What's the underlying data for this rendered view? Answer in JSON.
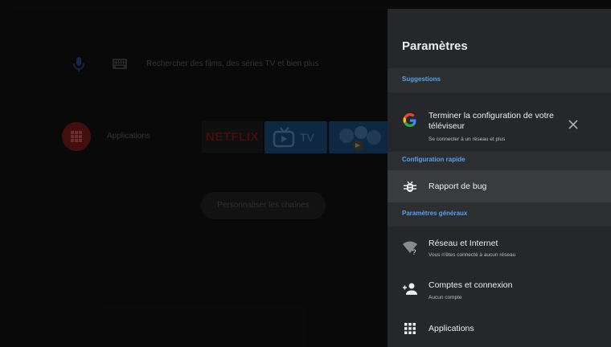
{
  "home": {
    "search_placeholder": "Rechercher des films, des séries TV et bien plus",
    "apps_label": "Applications",
    "netflix_label": "NETFLIX",
    "tv_label": "TV",
    "customize_label": "Personnaliser les chaînes"
  },
  "settings": {
    "title": "Paramètres",
    "sections": {
      "suggestions": "Suggestions",
      "quick": "Configuration rapide",
      "general": "Paramètres généraux"
    },
    "suggestion": {
      "title": "Terminer la configuration de votre téléviseur",
      "subtitle": "Se connecter à un réseau et plus",
      "icon": "google-icon"
    },
    "quick_items": [
      {
        "label": "Rapport de bug",
        "icon": "bug-icon"
      }
    ],
    "general_items": [
      {
        "label": "Réseau et Internet",
        "subtitle": "Vous n'êtes connecté à aucun réseau",
        "icon": "wifi-unknown-icon"
      },
      {
        "label": "Comptes et connexion",
        "subtitle": "Aucun compte",
        "icon": "add-account-icon"
      },
      {
        "label": "Applications",
        "icon": "apps-grid-icon"
      }
    ]
  },
  "colors": {
    "accent": "#5aa0e8",
    "panel": "#26272a",
    "focused": "#3a3b3e"
  }
}
